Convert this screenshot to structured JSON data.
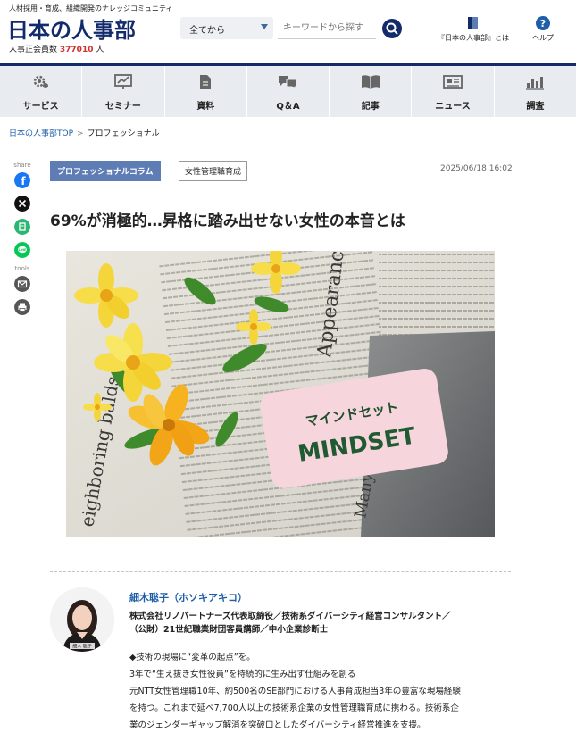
{
  "header": {
    "tagline": "人材採用・育成、組織開発のナレッジコミュニティ",
    "logo": "日本の人事部",
    "members_prefix": "人事正会員数",
    "members_count": "377010",
    "members_suffix": "人",
    "search": {
      "scope_value": "全てから",
      "placeholder": "キーワードから探す"
    },
    "links": {
      "about": "『日本の人事部』とは",
      "help": "ヘルプ"
    }
  },
  "nav": {
    "items": [
      {
        "label": "サービス",
        "icon": "service-icon"
      },
      {
        "label": "セミナー",
        "icon": "seminar-icon"
      },
      {
        "label": "資料",
        "icon": "document-icon"
      },
      {
        "label": "Q＆A",
        "icon": "qa-icon"
      },
      {
        "label": "記事",
        "icon": "article-icon"
      },
      {
        "label": "ニュース",
        "icon": "news-icon"
      },
      {
        "label": "調査",
        "icon": "survey-icon"
      }
    ]
  },
  "breadcrumb": {
    "home": "日本の人事部TOP",
    "separator": ">",
    "current": "プロフェッショナル"
  },
  "share": {
    "label": "share",
    "tools_label": "tools"
  },
  "article": {
    "category": "プロフェッショナルコラム",
    "tag": "女性管理職育成",
    "date": "2025/06/18 16:02",
    "title": "69%が消極的…昇格に踏み出せない女性の本音とは",
    "image_text": {
      "card_katakana": "マインドセット",
      "card_english": "MINDSET",
      "paper_1": "Appearance of",
      "paper_2": "eighboring balds.",
      "paper_3": "Many"
    }
  },
  "author": {
    "name": "細木聡子（ホソキアキコ）",
    "titles": [
      "株式会社リノパートナーズ代表取締役／技術系ダイバーシティ経営コンサルタント／",
      "（公財）21世紀職業財団客員講師／中小企業診断士"
    ],
    "avatar_caption": "細木 聡子",
    "bio": [
      "◆技術の現場に“変革の起点”を。",
      "3年で“生え抜き女性役員”を持続的に生み出す仕組みを創る",
      "元NTT女性管理職10年、約500名のSE部門における人事育成担当3年の豊富な現場経験",
      "を持つ。これまで延べ7,700人以上の技術系企業の女性管理職育成に携わる。技術系企",
      "業のジェンダーギャップ解消を突破口としたダイバーシティ経営推進を支援。"
    ]
  },
  "colors": {
    "brand_navy": "#132b6b",
    "accent_red": "#d0312d",
    "link_blue": "#1e5fa8",
    "badge_blue": "#5f7db5",
    "nav_bg": "#e8ebef"
  }
}
